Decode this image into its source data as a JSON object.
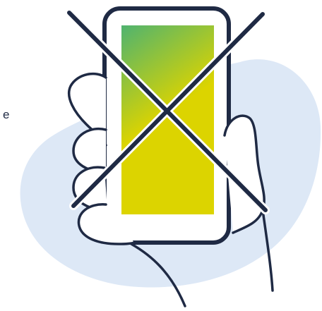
{
  "fragment_text": "e",
  "colors": {
    "outline": "#1f2a44",
    "blob": "#dde8f6",
    "screen_top": "#4fb36f",
    "screen_bottom": "#dcd400",
    "phone_body": "#ffffff"
  },
  "icons": {
    "main": "hand-holding-phone-crossed-out-icon"
  }
}
